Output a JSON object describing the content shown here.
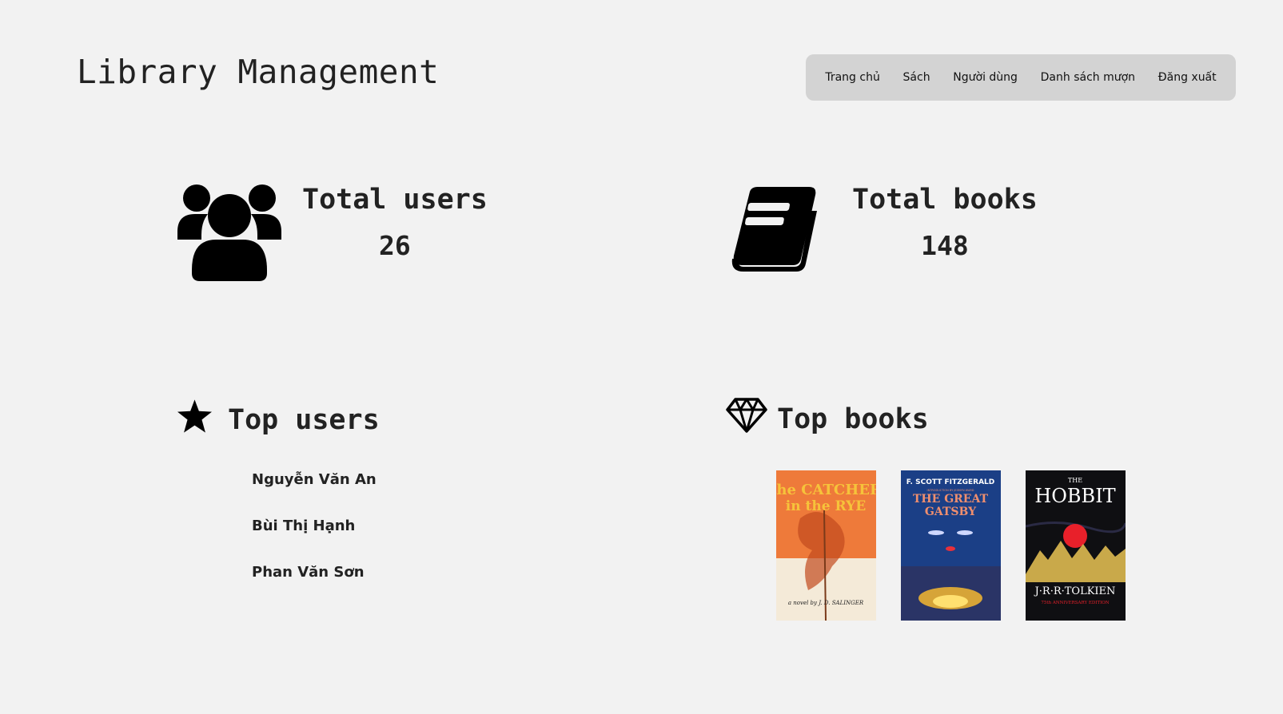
{
  "header": {
    "title": "Library Management"
  },
  "nav": {
    "items": [
      "Trang chủ",
      "Sách",
      "Người dùng",
      "Danh sách mượn",
      "Đăng xuất"
    ]
  },
  "stats": {
    "users": {
      "label": "Total users",
      "value": "26",
      "icon": "users-icon"
    },
    "books": {
      "label": "Total books",
      "value": "148",
      "icon": "book-icon"
    }
  },
  "top_users": {
    "heading": "Top users",
    "icon": "star-icon",
    "items": [
      "Nguyễn Văn An",
      "Bùi Thị Hạnh",
      "Phan Văn Sơn"
    ]
  },
  "top_books": {
    "heading": "Top books",
    "icon": "diamond-icon",
    "covers": [
      {
        "title_line1": "the CATCHER",
        "title_line2": "in the RYE",
        "author": "a novel by J. D. SALINGER",
        "colors": {
          "bg": "#ee7a3a",
          "lower": "#f4ead8",
          "text": "#f6c33a"
        }
      },
      {
        "author": "F. SCOTT FITZGERALD",
        "subtitle": "INTRODUCTION BY JESMYN WARD",
        "title_line1": "THE GREAT",
        "title_line2": "GATSBY",
        "colors": {
          "bg": "#1b3f86",
          "text": "#f08f6e"
        }
      },
      {
        "title_small": "THE",
        "title_line1": "HOBBIT",
        "author": "J·R·R·TOLKIEN",
        "edition": "75th ANNIVERSARY EDITION",
        "colors": {
          "bg": "#0f0f12",
          "sun": "#e8202a",
          "mountains": "#c9a94a"
        }
      }
    ]
  },
  "colors": {
    "background": "#f2f2f2",
    "navbar": "#d3d3d3",
    "text": "#222222"
  }
}
